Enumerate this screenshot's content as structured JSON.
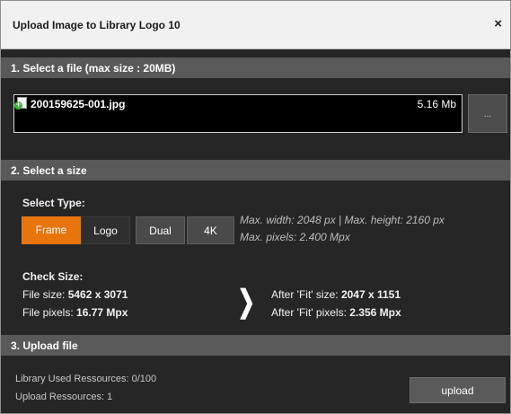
{
  "dialog": {
    "title": "Upload Image to Library Logo 10",
    "close_symbol": "×"
  },
  "section1": {
    "heading": "1. Select a file (max size : 20MB)",
    "file_icon": "image-file-add-icon",
    "file_name": "200159625-001.jpg",
    "file_size": "5.16 Mb",
    "browse_label": "..."
  },
  "section2": {
    "heading": "2. Select a size",
    "select_type_label": "Select Type:",
    "types": [
      {
        "label": "Frame",
        "selected": true
      },
      {
        "label": "Logo",
        "selected": false
      },
      {
        "label": "Dual",
        "selected": false
      },
      {
        "label": "4K",
        "selected": false
      }
    ],
    "max_dimensions": "Max. width: 2048 px  |  Max. height: 2160 px",
    "max_pixels": "Max. pixels: 2.400 Mpx",
    "check_size_label": "Check Size:",
    "file_size_label": "File size:",
    "file_size_value": "5462 x 3071",
    "file_pixels_label": "File pixels:",
    "file_pixels_value": "16.77 Mpx",
    "arrow_symbol": "❯",
    "fit_size_label": "After 'Fit' size:",
    "fit_size_value": "2047 x 1151",
    "fit_pixels_label": "After 'Fit' pixels:",
    "fit_pixels_value": "2.356 Mpx"
  },
  "section3": {
    "heading": "3. Upload file",
    "library_used": "Library Used Ressources: 0/100",
    "upload_resources": "Upload Ressources: 1",
    "upload_label": "upload"
  },
  "colors": {
    "accent": "#e8740e",
    "panel_bg": "#262626",
    "section_bar": "#595959"
  }
}
